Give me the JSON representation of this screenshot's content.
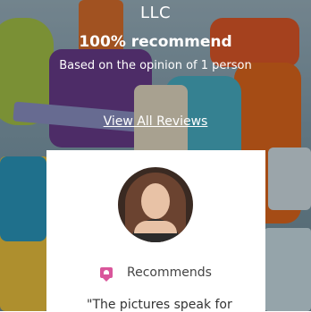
{
  "header": {
    "company_name": "LLC",
    "recommend_percent": "100% recommend",
    "basis_text": "Based on the opinion of 1 person"
  },
  "links": {
    "view_all_reviews": "View All Reviews"
  },
  "review_card": {
    "recommend_label": "Recommends",
    "quote_text": "\"The pictures speak for",
    "icon": "recommend-chat-heart-icon",
    "accent_color": "#d9569b"
  }
}
